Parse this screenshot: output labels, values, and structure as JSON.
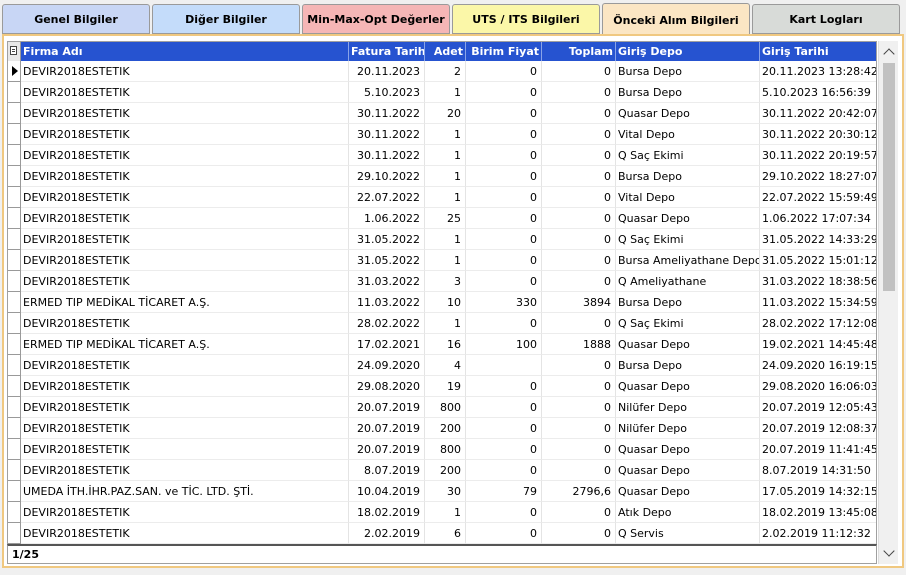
{
  "tabs": [
    {
      "label": "Genel Bilgiler",
      "bg": "#c8d6f5"
    },
    {
      "label": "Diğer Bilgiler",
      "bg": "#c4dcfa"
    },
    {
      "label": "Min-Max-Opt Değerler",
      "bg": "#f5b6b6"
    },
    {
      "label": "UTS / ITS Bilgileri",
      "bg": "#fbf7a8"
    },
    {
      "label": "Önceki Alım Bilgileri",
      "bg": "#fbe6c4"
    },
    {
      "label": "Kart Logları",
      "bg": "#d8dbd8"
    }
  ],
  "active_tab_index": 4,
  "colors": {
    "header_bg": "#2653d0",
    "panel_border": "#f0c880"
  },
  "grid": {
    "columns": [
      "Firma Adı",
      "Fatura Tarihi",
      "Adet",
      "Birim Fiyat",
      "Toplam",
      "Giriş Depo",
      "Giriş Tarihi"
    ],
    "rows": [
      [
        "DEVIR2018ESTETIK",
        "20.11.2023",
        "2",
        "0",
        "0",
        "Bursa Depo",
        "20.11.2023 13:28:42"
      ],
      [
        "DEVIR2018ESTETIK",
        "5.10.2023",
        "1",
        "0",
        "0",
        "Bursa Depo",
        "5.10.2023 16:56:39"
      ],
      [
        "DEVIR2018ESTETIK",
        "30.11.2022",
        "20",
        "0",
        "0",
        "Quasar Depo",
        "30.11.2022 20:42:07"
      ],
      [
        "DEVIR2018ESTETIK",
        "30.11.2022",
        "1",
        "0",
        "0",
        "Vital Depo",
        "30.11.2022 20:30:12"
      ],
      [
        "DEVIR2018ESTETIK",
        "30.11.2022",
        "1",
        "0",
        "0",
        "Q Saç Ekimi",
        "30.11.2022 20:19:57"
      ],
      [
        "DEVIR2018ESTETIK",
        "29.10.2022",
        "1",
        "0",
        "0",
        "Bursa Depo",
        "29.10.2022 18:27:07"
      ],
      [
        "DEVIR2018ESTETIK",
        "22.07.2022",
        "1",
        "0",
        "0",
        "Vital Depo",
        "22.07.2022 15:59:49"
      ],
      [
        "DEVIR2018ESTETIK",
        "1.06.2022",
        "25",
        "0",
        "0",
        "Quasar Depo",
        "1.06.2022 17:07:34"
      ],
      [
        "DEVIR2018ESTETIK",
        "31.05.2022",
        "1",
        "0",
        "0",
        "Q Saç Ekimi",
        "31.05.2022 14:33:29"
      ],
      [
        "DEVIR2018ESTETIK",
        "31.05.2022",
        "1",
        "0",
        "0",
        "Bursa Ameliyathane Depo",
        "31.05.2022 15:01:12"
      ],
      [
        "DEVIR2018ESTETIK",
        "31.03.2022",
        "3",
        "0",
        "0",
        "Q Ameliyathane",
        "31.03.2022 18:38:56"
      ],
      [
        "ERMED TIP MEDİKAL TİCARET A.Ş.",
        "11.03.2022",
        "10",
        "330",
        "3894",
        "Bursa Depo",
        "11.03.2022 15:34:59"
      ],
      [
        "DEVIR2018ESTETIK",
        "28.02.2022",
        "1",
        "0",
        "0",
        "Q Saç Ekimi",
        "28.02.2022 17:12:08"
      ],
      [
        "ERMED TIP MEDİKAL TİCARET A.Ş.",
        "17.02.2021",
        "16",
        "100",
        "1888",
        "Quasar Depo",
        "19.02.2021 14:45:48"
      ],
      [
        "DEVIR2018ESTETIK",
        "24.09.2020",
        "4",
        "",
        "0",
        "Bursa Depo",
        "24.09.2020 16:19:15"
      ],
      [
        "DEVIR2018ESTETIK",
        "29.08.2020",
        "19",
        "0",
        "0",
        "Quasar Depo",
        "29.08.2020 16:06:03"
      ],
      [
        "DEVIR2018ESTETIK",
        "20.07.2019",
        "800",
        "0",
        "0",
        "Nilüfer Depo",
        "20.07.2019 12:05:43"
      ],
      [
        "DEVIR2018ESTETIK",
        "20.07.2019",
        "200",
        "0",
        "0",
        "Nilüfer Depo",
        "20.07.2019 12:08:37"
      ],
      [
        "DEVIR2018ESTETIK",
        "20.07.2019",
        "800",
        "0",
        "0",
        "Quasar Depo",
        "20.07.2019 11:41:45"
      ],
      [
        "DEVIR2018ESTETIK",
        "8.07.2019",
        "200",
        "0",
        "0",
        "Quasar Depo",
        "8.07.2019 14:31:50"
      ],
      [
        "UMEDA İTH.İHR.PAZ.SAN. ve TİC. LTD. ŞTİ.",
        "10.04.2019",
        "30",
        "79",
        "2796,6",
        "Quasar Depo",
        "17.05.2019 14:32:15"
      ],
      [
        "DEVIR2018ESTETIK",
        "18.02.2019",
        "1",
        "0",
        "0",
        "Atık Depo",
        "18.02.2019 13:45:08"
      ],
      [
        "DEVIR2018ESTETIK",
        "2.02.2019",
        "6",
        "0",
        "0",
        "Q Servis",
        "2.02.2019 11:12:32"
      ]
    ]
  },
  "footer": {
    "record_position": "1/25"
  }
}
